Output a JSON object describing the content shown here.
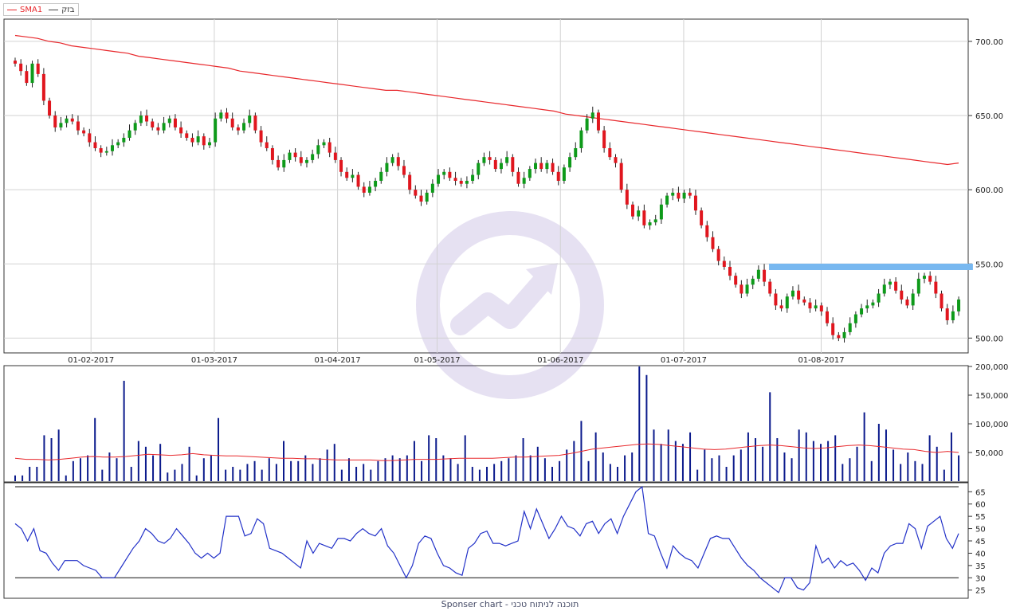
{
  "legend": [
    {
      "label": "SMA1",
      "color": "#e8282c"
    },
    {
      "label": "בזק",
      "color": "#444444"
    }
  ],
  "footer": "Sponser chart - תוכנה לניתוח טכני",
  "colors": {
    "up": "#0e9a1a",
    "down": "#e0161e",
    "sma": "#e8282c",
    "volume": "#0b1a8c",
    "rsi": "#2231c8",
    "resistance": "#78b8f0",
    "grid": "#d2d2d2",
    "border": "#333333"
  },
  "chart_data": [
    {
      "type": "candlestick",
      "name": "price",
      "ylim": [
        490,
        715
      ],
      "yticks": [
        500,
        550,
        600,
        650,
        700
      ],
      "ytick_labels": [
        "500.00",
        "550.00",
        "600.00",
        "650.00",
        "700.00"
      ],
      "xtick_labels": [
        "01-02-2017",
        "01-03-2017",
        "01-04-2017",
        "01-05-2017",
        "01-06-2017",
        "01-07-2017",
        "01-08-2017"
      ],
      "xtick_indices": [
        16,
        42,
        68,
        89,
        115,
        141,
        170
      ],
      "x_count": 200,
      "grid": true,
      "close": [
        685,
        680,
        672,
        685,
        678,
        660,
        650,
        642,
        645,
        648,
        646,
        640,
        638,
        632,
        628,
        625,
        626,
        630,
        632,
        635,
        640,
        645,
        650,
        646,
        642,
        640,
        645,
        648,
        642,
        638,
        635,
        632,
        636,
        630,
        632,
        648,
        652,
        648,
        642,
        640,
        645,
        650,
        640,
        632,
        628,
        620,
        615,
        620,
        625,
        622,
        618,
        620,
        624,
        630,
        632,
        625,
        620,
        612,
        608,
        610,
        602,
        598,
        602,
        606,
        612,
        618,
        622,
        616,
        610,
        600,
        596,
        592,
        598,
        604,
        610,
        612,
        608,
        606,
        604,
        606,
        610,
        618,
        622,
        620,
        614,
        618,
        622,
        612,
        604,
        608,
        614,
        618,
        614,
        618,
        612,
        606,
        615,
        622,
        628,
        640,
        648,
        652,
        640,
        628,
        622,
        618,
        600,
        590,
        582,
        586,
        576,
        578,
        580,
        590,
        596,
        598,
        594,
        598,
        596,
        586,
        576,
        568,
        560,
        552,
        548,
        542,
        536,
        530,
        536,
        540,
        546,
        538,
        530,
        522,
        520,
        528,
        532,
        526,
        524,
        520,
        522,
        518,
        510,
        502,
        500,
        504,
        510,
        516,
        520,
        522,
        524,
        530,
        536,
        538,
        532,
        526,
        522,
        530,
        540,
        542,
        538,
        530,
        520,
        512,
        518,
        526
      ],
      "sma": [
        704,
        703,
        702,
        700,
        699,
        697,
        696,
        695,
        694,
        693,
        692,
        690,
        689,
        688,
        687,
        686,
        685,
        684,
        683,
        682,
        680,
        679,
        678,
        677,
        676,
        675,
        674,
        673,
        672,
        671,
        670,
        669,
        668,
        667,
        667,
        666,
        665,
        664,
        663,
        662,
        661,
        660,
        659,
        658,
        657,
        656,
        655,
        654,
        653,
        651,
        650,
        649,
        648,
        647,
        646,
        645,
        644,
        643,
        642,
        641,
        640,
        639,
        638,
        637,
        636,
        635,
        634,
        633,
        632,
        631,
        630,
        629,
        628,
        627,
        626,
        625,
        624,
        623,
        622,
        621,
        620,
        619,
        618,
        617,
        618
      ],
      "resistance": {
        "from": 159,
        "to": 202,
        "value": 548
      }
    },
    {
      "type": "bar",
      "name": "volume",
      "ylim": [
        0,
        200000
      ],
      "yticks": [
        50000,
        100000,
        150000,
        200000
      ],
      "ytick_labels": [
        "50,000",
        "100,000",
        "150,000",
        "200,000"
      ],
      "values": [
        10000,
        10000,
        25000,
        25000,
        80000,
        75000,
        90000,
        10000,
        35000,
        40000,
        45000,
        110000,
        20000,
        50000,
        40000,
        175000,
        25000,
        70000,
        60000,
        45000,
        65000,
        15000,
        20000,
        30000,
        60000,
        10000,
        40000,
        45000,
        110000,
        20000,
        25000,
        20000,
        30000,
        35000,
        20000,
        40000,
        30000,
        70000,
        35000,
        35000,
        45000,
        30000,
        40000,
        55000,
        65000,
        20000,
        40000,
        25000,
        30000,
        20000,
        35000,
        40000,
        45000,
        40000,
        45000,
        70000,
        35000,
        80000,
        75000,
        45000,
        40000,
        30000,
        80000,
        25000,
        20000,
        25000,
        30000,
        35000,
        40000,
        45000,
        75000,
        45000,
        60000,
        40000,
        25000,
        35000,
        55000,
        70000,
        105000,
        35000,
        85000,
        50000,
        30000,
        25000,
        45000,
        50000,
        200000,
        185000,
        90000,
        65000,
        90000,
        70000,
        65000,
        85000,
        20000,
        55000,
        40000,
        45000,
        25000,
        45000,
        55000,
        85000,
        75000,
        60000,
        155000,
        75000,
        50000,
        40000,
        90000,
        85000,
        70000,
        65000,
        70000,
        80000,
        30000,
        40000,
        60000,
        120000,
        35000,
        100000,
        90000,
        55000,
        30000,
        50000,
        35000,
        30000,
        80000,
        60000,
        20000,
        85000,
        45000
      ],
      "avg": [
        40000,
        38000,
        38000,
        37000,
        38000,
        40000,
        42000,
        43000,
        42000,
        42000,
        43000,
        45000,
        47000,
        46000,
        45000,
        46000,
        48000,
        46000,
        45000,
        44000,
        44000,
        43000,
        42000,
        41000,
        40000,
        40000,
        39000,
        39000,
        38000,
        37000,
        37000,
        37000,
        37000,
        36000,
        36000,
        37000,
        38000,
        38000,
        38000,
        39000,
        40000,
        40000,
        40000,
        40000,
        41000,
        42000,
        42000,
        43000,
        44000,
        45000,
        48000,
        52000,
        56000,
        58000,
        60000,
        62000,
        64000,
        65000,
        64000,
        62000,
        60000,
        58000,
        56000,
        55000,
        56000,
        58000,
        60000,
        62000,
        63000,
        62000,
        60000,
        58000,
        57000,
        58000,
        60000,
        62000,
        63000,
        62000,
        60000,
        58000,
        56000,
        55000,
        52000,
        50000,
        52000,
        50000
      ]
    },
    {
      "type": "line",
      "name": "rsi",
      "ylim": [
        22,
        68
      ],
      "yticks": [
        25,
        30,
        35,
        40,
        45,
        50,
        55,
        60,
        65
      ],
      "ytick_labels": [
        "25",
        "30",
        "35",
        "40",
        "45",
        "50",
        "55",
        "60",
        "65"
      ],
      "levels": [
        30,
        70
      ],
      "values": [
        52,
        50,
        45,
        50,
        41,
        40,
        36,
        33,
        37,
        37,
        37,
        35,
        34,
        33,
        30,
        30,
        30,
        34,
        38,
        42,
        45,
        50,
        48,
        45,
        44,
        46,
        50,
        47,
        44,
        40,
        38,
        40,
        38,
        40,
        55,
        55,
        55,
        47,
        48,
        54,
        52,
        42,
        41,
        40,
        38,
        36,
        34,
        45,
        40,
        44,
        43,
        42,
        46,
        46,
        45,
        48,
        50,
        48,
        47,
        50,
        43,
        40,
        35,
        30,
        35,
        44,
        47,
        46,
        40,
        35,
        34,
        32,
        31,
        42,
        44,
        48,
        49,
        44,
        44,
        43,
        44,
        45,
        57,
        50,
        58,
        52,
        46,
        50,
        55,
        51,
        50,
        47,
        52,
        53,
        48,
        52,
        54,
        48,
        55,
        60,
        65,
        67,
        48,
        47,
        40,
        34,
        43,
        40,
        38,
        37,
        34,
        40,
        46,
        47,
        46,
        46,
        42,
        38,
        35,
        33,
        30,
        28,
        26,
        24,
        30,
        30,
        26,
        25,
        28,
        43,
        36,
        38,
        34,
        37,
        35,
        36,
        33,
        29,
        34,
        32,
        40,
        43,
        44,
        44,
        52,
        50,
        42,
        51,
        53,
        55,
        46,
        42,
        48
      ]
    }
  ]
}
